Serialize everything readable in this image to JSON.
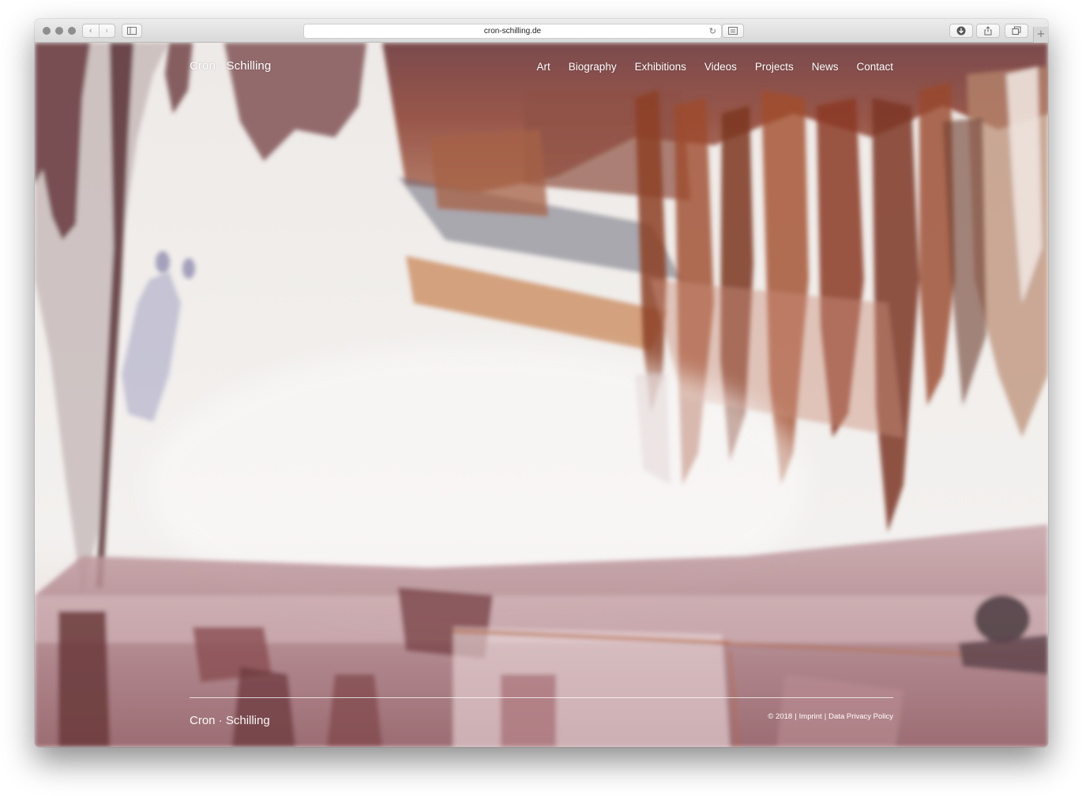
{
  "browser": {
    "url": "cron-schilling.de",
    "back_icon": "chevron-left-icon",
    "forward_icon": "chevron-right-icon",
    "sidebar_icon": "sidebar-icon",
    "reload_icon": "reload-icon",
    "reader_icon": "reader-icon",
    "download_icon": "download-icon",
    "share_icon": "share-icon",
    "tabs_icon": "tabs-icon",
    "new_tab_icon": "plus-icon"
  },
  "site": {
    "logo": "Cron · Schilling",
    "nav": [
      "Art",
      "Biography",
      "Exhibitions",
      "Videos",
      "Projects",
      "News",
      "Contact"
    ]
  },
  "footer": {
    "logo": "Cron · Schilling",
    "copyright": "© 2018",
    "sep1": "|",
    "imprint": "Imprint",
    "sep2": "|",
    "privacy": "Data Privacy Policy"
  },
  "colors": {
    "chrome": "#dcdcdc",
    "text_on_image": "#ffffff",
    "paint_rust": "#9a4a2c",
    "paint_plum": "#7a4a52",
    "paper": "#f2f0ee"
  }
}
